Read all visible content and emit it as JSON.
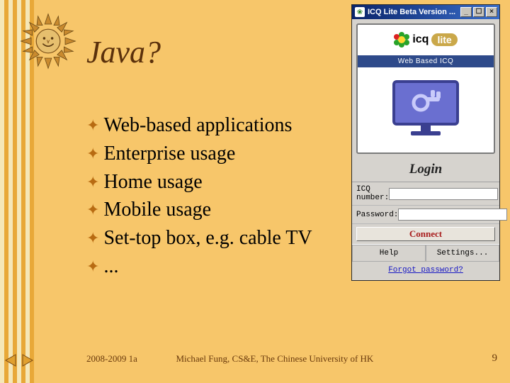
{
  "slide": {
    "title": "Java?",
    "bullets": [
      "Web-based applications",
      "Enterprise usage",
      "Home usage",
      "Mobile usage",
      "Set-top box, e.g. cable TV",
      "..."
    ]
  },
  "footer": {
    "left": "2008-2009 1a",
    "center": "Michael Fung, CS&E, The Chinese University of HK",
    "page": "9"
  },
  "icq": {
    "titlebar": "ICQ Lite Beta Version ...",
    "logo_text": "icq",
    "logo_pill": "lite",
    "web_band": "Web Based ICQ",
    "login_heading": "Login",
    "icq_number_label": "ICQ number:",
    "icq_number_value": "",
    "password_label": "Password:",
    "password_value": "",
    "connect": "Connect",
    "help": "Help",
    "settings": "Settings...",
    "forgot": "Forgot password?"
  }
}
